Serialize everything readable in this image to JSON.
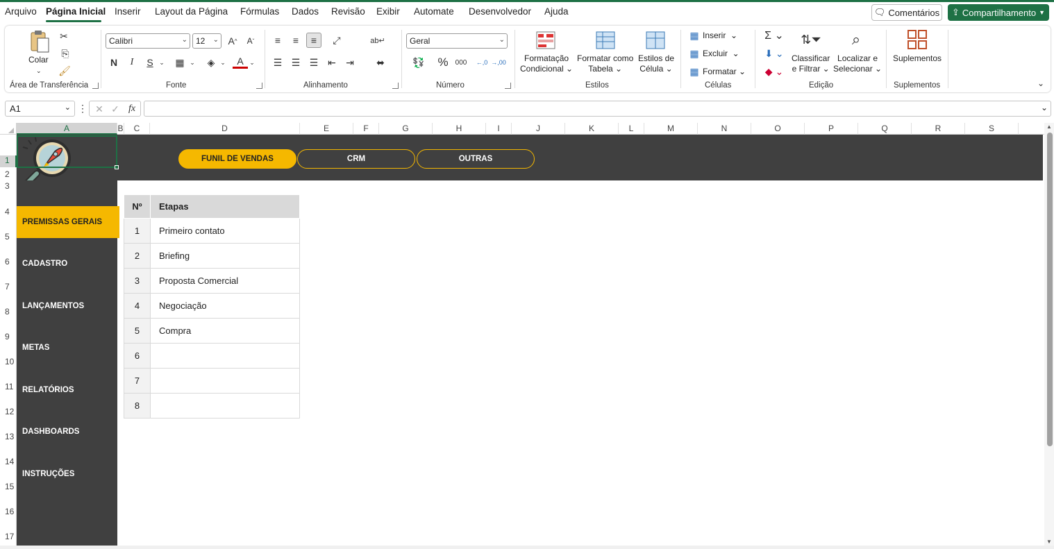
{
  "menu": {
    "items": [
      "Arquivo",
      "Página Inicial",
      "Inserir",
      "Layout da Página",
      "Fórmulas",
      "Dados",
      "Revisão",
      "Exibir",
      "Automate",
      "Desenvolvedor",
      "Ajuda"
    ],
    "active": "Página Inicial",
    "comments_label": "Comentários",
    "share_label": "Compartilhamento"
  },
  "ribbon": {
    "clipboard": {
      "paste_label": "Colar",
      "group_label": "Área de Transferência"
    },
    "font": {
      "font_name": "Calibri",
      "font_size": "12",
      "group_label": "Fonte",
      "bold": "N",
      "italic": "I",
      "underline": "S"
    },
    "alignment": {
      "group_label": "Alinhamento"
    },
    "number": {
      "format": "Geral",
      "group_label": "Número"
    },
    "styles": {
      "conditional_1": "Formatação",
      "conditional_2": "Condicional",
      "table_1": "Formatar como",
      "table_2": "Tabela",
      "cell_1": "Estilos de",
      "cell_2": "Célula",
      "group_label": "Estilos"
    },
    "cells": {
      "insert": "Inserir",
      "delete": "Excluir",
      "format": "Formatar",
      "group_label": "Células"
    },
    "editing": {
      "sort_1": "Classificar",
      "sort_2": "e Filtrar",
      "find_1": "Localizar e",
      "find_2": "Selecionar",
      "group_label": "Edição"
    },
    "addins": {
      "label": "Suplementos",
      "group_label": "Suplementos"
    }
  },
  "formula_bar": {
    "name_box": "A1",
    "formula": ""
  },
  "columns": [
    "A",
    "B",
    "C",
    "D",
    "E",
    "F",
    "G",
    "H",
    "I",
    "J",
    "K",
    "L",
    "M",
    "N",
    "O",
    "P",
    "Q",
    "R",
    "S"
  ],
  "rows": [
    "1",
    "2",
    "3",
    "4",
    "5",
    "6",
    "7",
    "8",
    "9",
    "10",
    "11",
    "12",
    "13",
    "14",
    "15",
    "16",
    "17"
  ],
  "sheet": {
    "top_nav": [
      "FUNIL DE VENDAS",
      "CRM",
      "OUTRAS"
    ],
    "top_nav_active": "FUNIL DE VENDAS",
    "sidebar": [
      "PREMISSAS GERAIS",
      "CADASTRO",
      "LANÇAMENTOS",
      "METAS",
      "RELATÓRIOS",
      "DASHBOARDS",
      "INSTRUÇÕES"
    ],
    "sidebar_active": "PREMISSAS GERAIS",
    "table": {
      "headers": [
        "Nº",
        "Etapas"
      ],
      "rows": [
        {
          "n": "1",
          "etapa": "Primeiro contato"
        },
        {
          "n": "2",
          "etapa": "Briefing"
        },
        {
          "n": "3",
          "etapa": "Proposta Comercial"
        },
        {
          "n": "4",
          "etapa": "Negociação"
        },
        {
          "n": "5",
          "etapa": "Compra"
        },
        {
          "n": "6",
          "etapa": ""
        },
        {
          "n": "7",
          "etapa": ""
        },
        {
          "n": "8",
          "etapa": ""
        }
      ]
    }
  },
  "colors": {
    "accent": "#f5b800",
    "dark": "#404040",
    "excel_green": "#1e7145"
  }
}
